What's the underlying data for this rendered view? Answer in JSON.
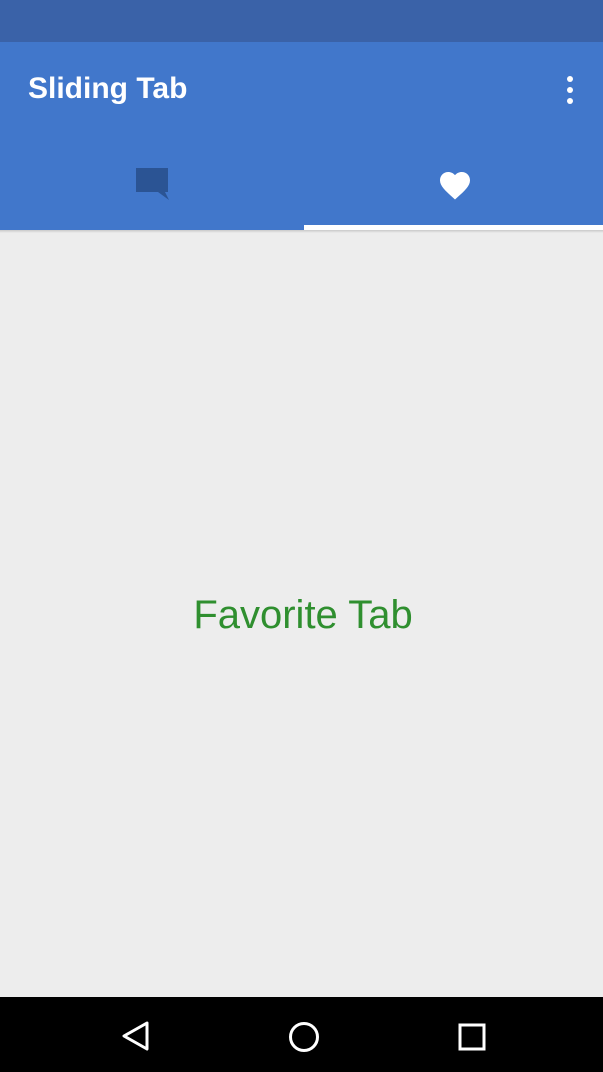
{
  "app_bar": {
    "title": "Sliding Tab",
    "overflow_icon": "more-vert-icon",
    "color": "#4177cb"
  },
  "status_bar": {
    "color": "#3a62a8"
  },
  "tabs": [
    {
      "icon": "chat-bubble-icon",
      "selected": false
    },
    {
      "icon": "heart-icon",
      "selected": true
    }
  ],
  "content": {
    "label": "Favorite Tab",
    "label_color": "#2f8f2f"
  },
  "nav_bar": {
    "buttons": [
      "back-icon",
      "home-icon",
      "recents-icon"
    ]
  }
}
